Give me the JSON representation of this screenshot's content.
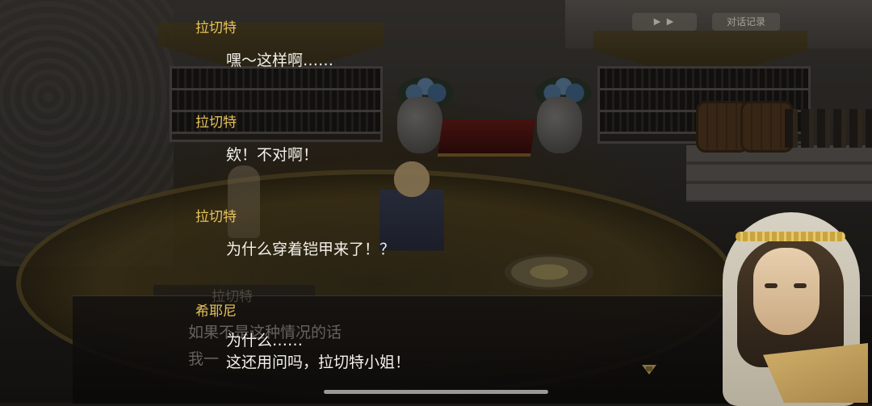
{
  "top_buttons": {
    "auto_label": "▶ ▶",
    "log_label": "对话记录"
  },
  "log": [
    {
      "speaker": "拉切特",
      "lines": [
        "嘿〜这样啊……"
      ]
    },
    {
      "speaker": "拉切特",
      "lines": [
        "欸！不对啊！"
      ]
    },
    {
      "speaker": "拉切特",
      "lines": [
        "为什么穿着铠甲来了！？"
      ]
    },
    {
      "speaker": "希耶尼",
      "lines": [
        "为什么……",
        "这还用问吗，拉切特小姐！"
      ]
    }
  ],
  "background_dialogue": {
    "speaker": "拉切特",
    "lines": [
      "如果不是这种情况的话",
      "我一"
    ]
  },
  "icons": {
    "next": "next-arrow-icon"
  },
  "colors": {
    "speaker_name": "#e6c35a",
    "dialogue_text": "#f4f1ea"
  }
}
